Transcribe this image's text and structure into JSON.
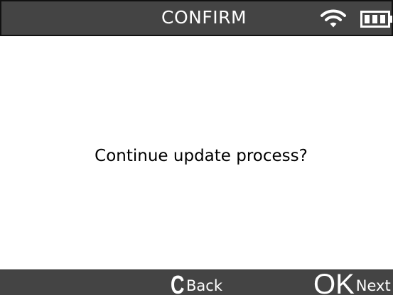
{
  "header": {
    "title": "CONFIRM",
    "wifi_icon": "wifi-icon",
    "battery_icon": "battery-full-icon"
  },
  "dialog": {
    "message": "Continue update process?"
  },
  "footer": {
    "back": {
      "key": "C",
      "label": "Back"
    },
    "next": {
      "key": "OK",
      "label": "Next"
    }
  },
  "colors": {
    "bar_background": "#444444",
    "bar_text": "#ffffff",
    "screen_background": "#ffffff",
    "message_text": "#000000"
  }
}
